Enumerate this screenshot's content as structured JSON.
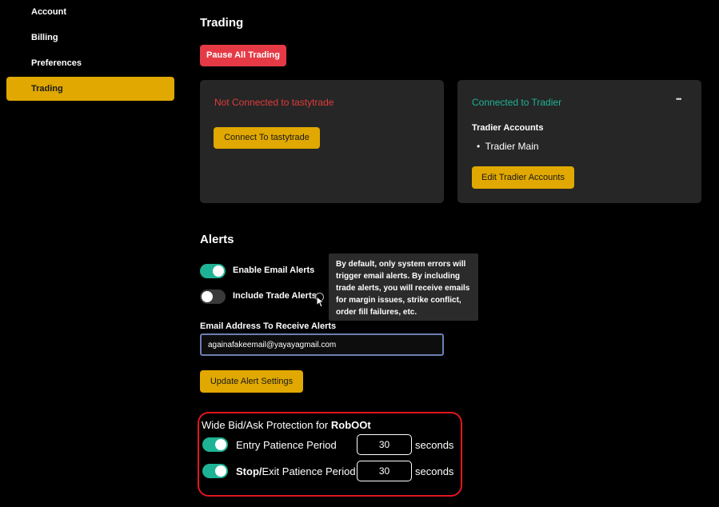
{
  "sidebar": {
    "items": [
      {
        "label": "Account",
        "active": false
      },
      {
        "label": "Billing",
        "active": false
      },
      {
        "label": "Preferences",
        "active": false
      },
      {
        "label": "Trading",
        "active": true
      }
    ]
  },
  "trading": {
    "title": "Trading",
    "pause_label": "Pause All Trading",
    "tastytrade": {
      "status": "Not Connected to tastytrade",
      "connect_label": "Connect To tastytrade"
    },
    "tradier": {
      "status": "Connected to Tradier",
      "menu_glyph": "•••",
      "accounts_heading": "Tradier Accounts",
      "accounts": [
        "Tradier Main"
      ],
      "edit_label": "Edit Tradier Accounts"
    }
  },
  "alerts": {
    "title": "Alerts",
    "enable_email_label": "Enable Email Alerts",
    "enable_email_on": true,
    "include_trade_label": "Include Trade Alerts",
    "include_trade_on": false,
    "tooltip": "By default, only system errors will trigger email alerts. By including trade alerts, you will receive emails for margin issues, strike conflict, order fill failures, etc.",
    "email_label": "Email Address To Receive Alerts",
    "email_value": "againafakeemail@yayayagmail.com",
    "update_label": "Update Alert Settings"
  },
  "protection": {
    "title_prefix": "Wide Bid/Ask Protection for",
    "title_brand": "RobOOt",
    "entry_label": "Entry Patience Period",
    "entry_on": true,
    "entry_value": "30",
    "exit_label_bold": "Stop/",
    "exit_label": "Exit Patience Period",
    "exit_on": true,
    "exit_value": "30",
    "unit": "seconds"
  },
  "colors": {
    "accent": "#e0a800",
    "danger": "#e53a45",
    "success": "#1fb395",
    "card": "#262626"
  }
}
